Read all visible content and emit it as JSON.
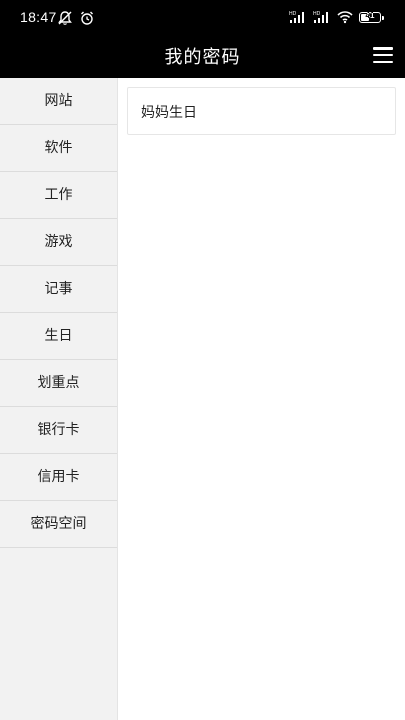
{
  "status_bar": {
    "time": "18:47",
    "battery": "41",
    "icons": [
      "mute-icon",
      "alarm-icon",
      "hd-signal-icon",
      "hd-signal-icon",
      "wifi-icon",
      "battery-icon"
    ]
  },
  "header": {
    "title": "我的密码",
    "menu_icon": "hamburger-menu-icon"
  },
  "sidebar": {
    "items": [
      {
        "label": "网站"
      },
      {
        "label": "软件"
      },
      {
        "label": "工作"
      },
      {
        "label": "游戏"
      },
      {
        "label": "记事"
      },
      {
        "label": "生日"
      },
      {
        "label": "划重点"
      },
      {
        "label": "银行卡"
      },
      {
        "label": "信用卡"
      },
      {
        "label": "密码空间"
      }
    ]
  },
  "main": {
    "entries": [
      {
        "label": "妈妈生日"
      }
    ]
  },
  "colors": {
    "header_bg": "#000000",
    "sidebar_bg": "#f2f2f2",
    "content_bg": "#ffffff"
  }
}
